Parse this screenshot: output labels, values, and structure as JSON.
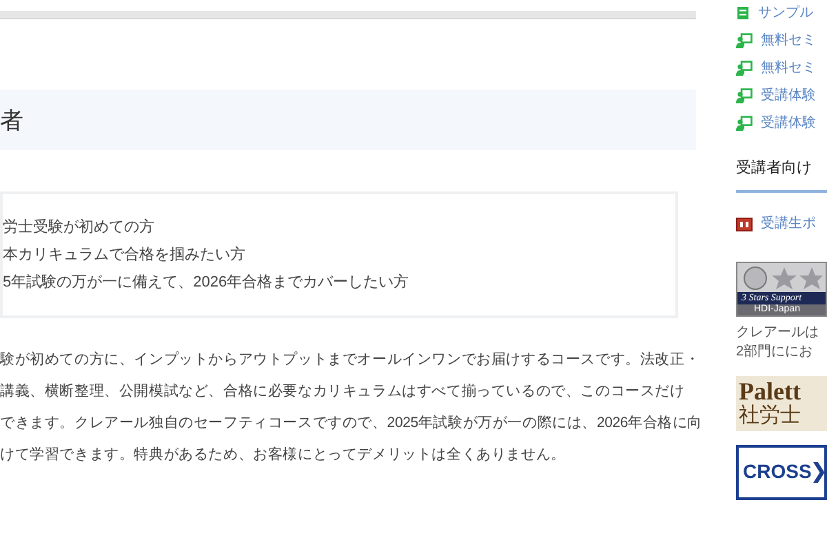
{
  "main": {
    "heading": "者",
    "target_list": [
      "労士受験が初めての方",
      "本カリキュラムで合格を掴みたい方",
      "5年試験の万が一に備えて、2026年合格までカバーしたい方"
    ],
    "description": [
      "験が初めての方に、インプットからアウトプットまでオールインワンでお届けするコースです。法改正・",
      "講義、横断整理、公開模試など、合格に必要なカリキュラムはすべて揃っているので、このコースだけ",
      "できます。クレアール独自のセーフティコースですので、2025年試験が万が一の際には、2026年合格に向",
      "けて学習できます。特典があるため、お客様にとってデメリットは全くありません。"
    ]
  },
  "sidebar": {
    "links": [
      {
        "kind": "book",
        "label": "サンプル"
      },
      {
        "kind": "seminar",
        "label": "無料セミ"
      },
      {
        "kind": "seminar",
        "label": "無料セミ"
      },
      {
        "kind": "seminar",
        "label": "受講体験"
      },
      {
        "kind": "seminar",
        "label": "受講体験"
      }
    ],
    "section_heading": "受講者向け",
    "student_links": [
      {
        "kind": "portal",
        "label": "受講生ポ"
      }
    ],
    "award_banner": {
      "title": "3 Stars Support",
      "subtitle": "HDI-Japan"
    },
    "award_caption": [
      "クレアールは",
      "2部門ににお"
    ],
    "palette_banner": {
      "line_1": "Palett",
      "line_2": "社労士"
    },
    "cross_banner": {
      "label": "CROSS"
    }
  }
}
